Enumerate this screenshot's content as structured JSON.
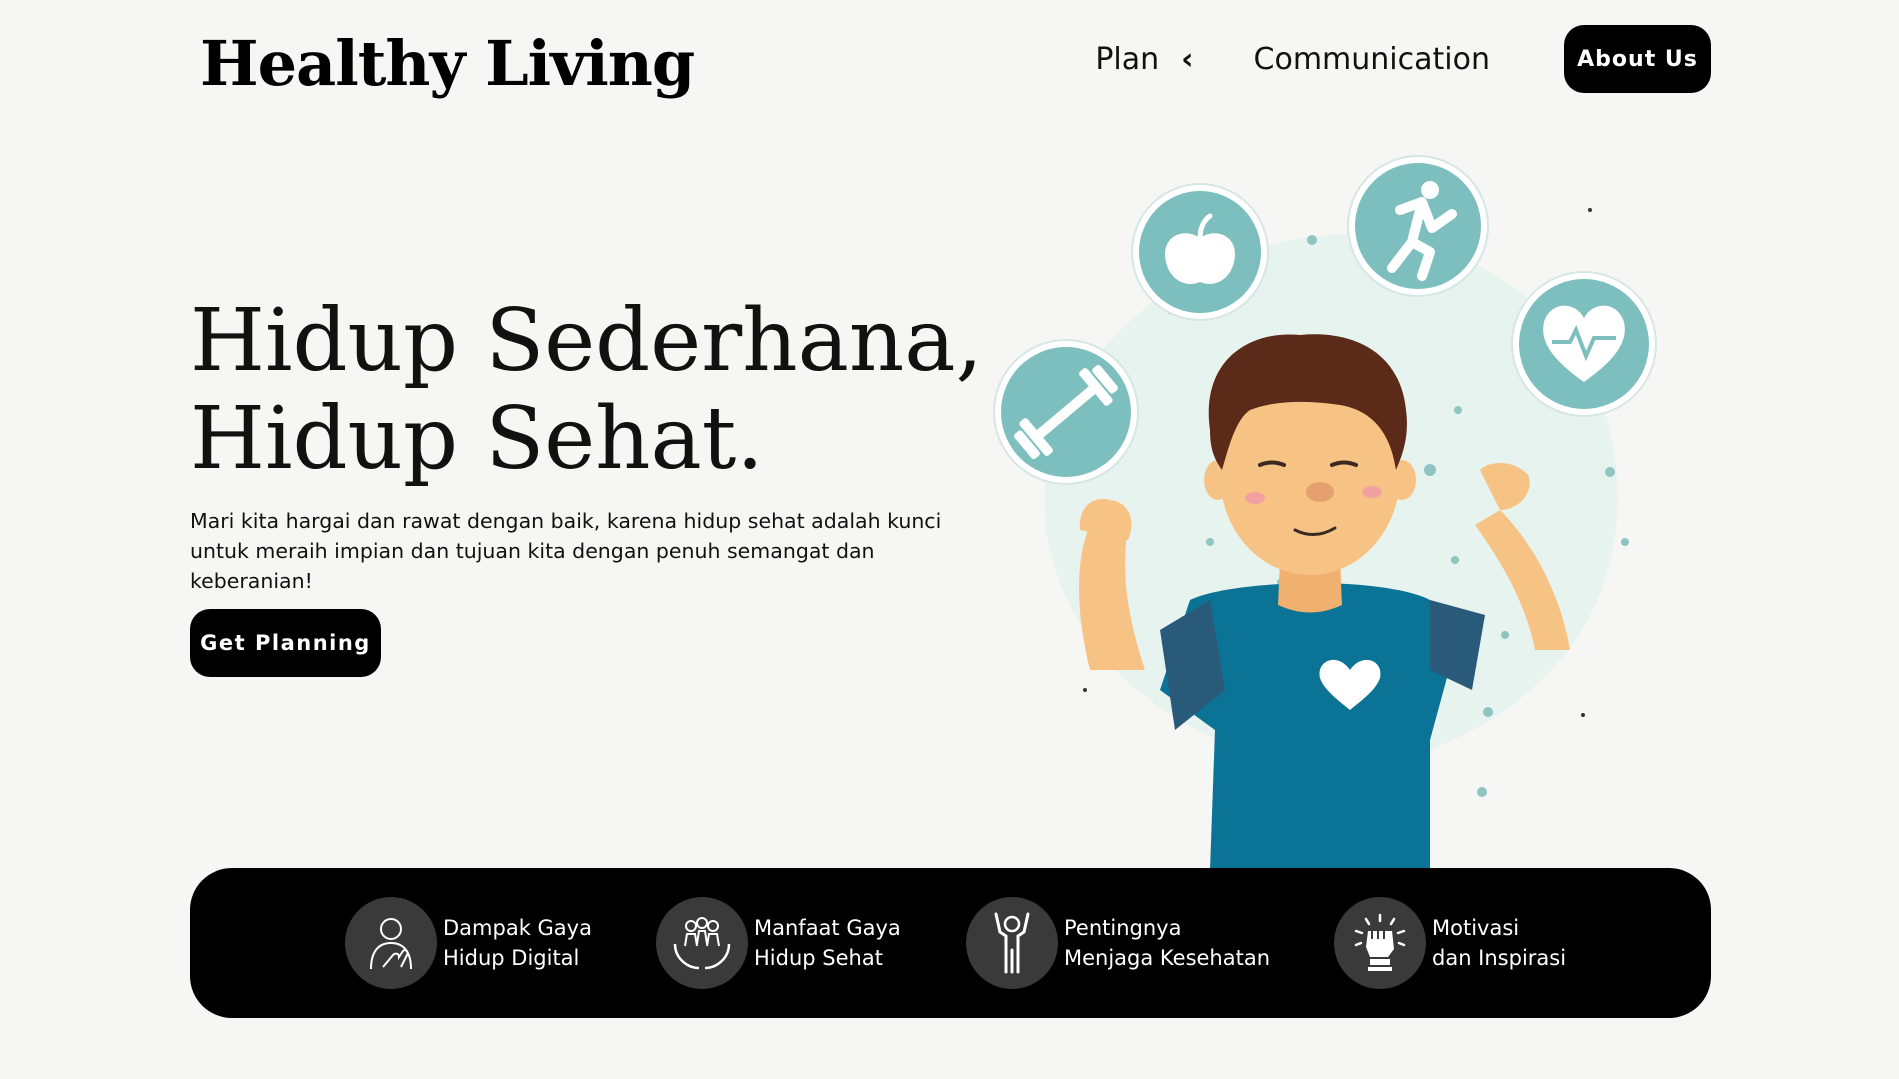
{
  "header": {
    "logo": "Healthy Living",
    "nav": {
      "plan_label": "Plan",
      "plan_chevron": "‹",
      "communication_label": "Communication",
      "about_label": "About Us"
    }
  },
  "hero": {
    "title_line1": "Hidup Sederhana,",
    "title_line2": "Hidup Sehat.",
    "description": "Mari kita hargai dan rawat dengan baik, karena hidup sehat adalah kunci untuk meraih impian dan tujuan kita dengan penuh semangat dan keberanian!",
    "cta_label": "Get Planning"
  },
  "illustration": {
    "icons": [
      "apple-icon",
      "running-icon",
      "heart-rate-icon",
      "dumbbell-icon"
    ]
  },
  "features": [
    {
      "line1": "Dampak Gaya",
      "line2": "Hidup Digital",
      "icon": "person-hand-icon"
    },
    {
      "line1": "Manfaat Gaya",
      "line2": "Hidup Sehat",
      "icon": "community-hands-icon"
    },
    {
      "line1": "Pentingnya",
      "line2": "Menjaga Kesehatan",
      "icon": "person-arms-up-icon"
    },
    {
      "line1": "Motivasi",
      "line2": "dan Inspirasi",
      "icon": "fist-icon"
    }
  ],
  "colors": {
    "background": "#f6f6f4",
    "primary": "#000000",
    "accent_teal": "#7dbfbf",
    "shirt": "#0a7396"
  }
}
